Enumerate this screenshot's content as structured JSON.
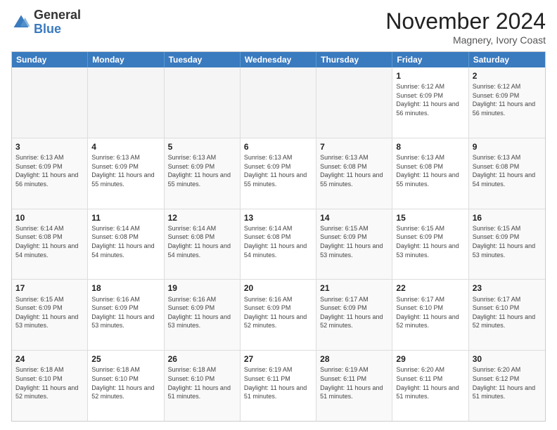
{
  "header": {
    "logo_general": "General",
    "logo_blue": "Blue",
    "month": "November 2024",
    "location": "Magnery, Ivory Coast"
  },
  "days_of_week": [
    "Sunday",
    "Monday",
    "Tuesday",
    "Wednesday",
    "Thursday",
    "Friday",
    "Saturday"
  ],
  "weeks": [
    [
      {
        "day": "",
        "text": ""
      },
      {
        "day": "",
        "text": ""
      },
      {
        "day": "",
        "text": ""
      },
      {
        "day": "",
        "text": ""
      },
      {
        "day": "",
        "text": ""
      },
      {
        "day": "1",
        "text": "Sunrise: 6:12 AM\nSunset: 6:09 PM\nDaylight: 11 hours and 56 minutes."
      },
      {
        "day": "2",
        "text": "Sunrise: 6:12 AM\nSunset: 6:09 PM\nDaylight: 11 hours and 56 minutes."
      }
    ],
    [
      {
        "day": "3",
        "text": "Sunrise: 6:13 AM\nSunset: 6:09 PM\nDaylight: 11 hours and 56 minutes."
      },
      {
        "day": "4",
        "text": "Sunrise: 6:13 AM\nSunset: 6:09 PM\nDaylight: 11 hours and 55 minutes."
      },
      {
        "day": "5",
        "text": "Sunrise: 6:13 AM\nSunset: 6:09 PM\nDaylight: 11 hours and 55 minutes."
      },
      {
        "day": "6",
        "text": "Sunrise: 6:13 AM\nSunset: 6:09 PM\nDaylight: 11 hours and 55 minutes."
      },
      {
        "day": "7",
        "text": "Sunrise: 6:13 AM\nSunset: 6:08 PM\nDaylight: 11 hours and 55 minutes."
      },
      {
        "day": "8",
        "text": "Sunrise: 6:13 AM\nSunset: 6:08 PM\nDaylight: 11 hours and 55 minutes."
      },
      {
        "day": "9",
        "text": "Sunrise: 6:13 AM\nSunset: 6:08 PM\nDaylight: 11 hours and 54 minutes."
      }
    ],
    [
      {
        "day": "10",
        "text": "Sunrise: 6:14 AM\nSunset: 6:08 PM\nDaylight: 11 hours and 54 minutes."
      },
      {
        "day": "11",
        "text": "Sunrise: 6:14 AM\nSunset: 6:08 PM\nDaylight: 11 hours and 54 minutes."
      },
      {
        "day": "12",
        "text": "Sunrise: 6:14 AM\nSunset: 6:08 PM\nDaylight: 11 hours and 54 minutes."
      },
      {
        "day": "13",
        "text": "Sunrise: 6:14 AM\nSunset: 6:08 PM\nDaylight: 11 hours and 54 minutes."
      },
      {
        "day": "14",
        "text": "Sunrise: 6:15 AM\nSunset: 6:09 PM\nDaylight: 11 hours and 53 minutes."
      },
      {
        "day": "15",
        "text": "Sunrise: 6:15 AM\nSunset: 6:09 PM\nDaylight: 11 hours and 53 minutes."
      },
      {
        "day": "16",
        "text": "Sunrise: 6:15 AM\nSunset: 6:09 PM\nDaylight: 11 hours and 53 minutes."
      }
    ],
    [
      {
        "day": "17",
        "text": "Sunrise: 6:15 AM\nSunset: 6:09 PM\nDaylight: 11 hours and 53 minutes."
      },
      {
        "day": "18",
        "text": "Sunrise: 6:16 AM\nSunset: 6:09 PM\nDaylight: 11 hours and 53 minutes."
      },
      {
        "day": "19",
        "text": "Sunrise: 6:16 AM\nSunset: 6:09 PM\nDaylight: 11 hours and 53 minutes."
      },
      {
        "day": "20",
        "text": "Sunrise: 6:16 AM\nSunset: 6:09 PM\nDaylight: 11 hours and 52 minutes."
      },
      {
        "day": "21",
        "text": "Sunrise: 6:17 AM\nSunset: 6:09 PM\nDaylight: 11 hours and 52 minutes."
      },
      {
        "day": "22",
        "text": "Sunrise: 6:17 AM\nSunset: 6:10 PM\nDaylight: 11 hours and 52 minutes."
      },
      {
        "day": "23",
        "text": "Sunrise: 6:17 AM\nSunset: 6:10 PM\nDaylight: 11 hours and 52 minutes."
      }
    ],
    [
      {
        "day": "24",
        "text": "Sunrise: 6:18 AM\nSunset: 6:10 PM\nDaylight: 11 hours and 52 minutes."
      },
      {
        "day": "25",
        "text": "Sunrise: 6:18 AM\nSunset: 6:10 PM\nDaylight: 11 hours and 52 minutes."
      },
      {
        "day": "26",
        "text": "Sunrise: 6:18 AM\nSunset: 6:10 PM\nDaylight: 11 hours and 51 minutes."
      },
      {
        "day": "27",
        "text": "Sunrise: 6:19 AM\nSunset: 6:11 PM\nDaylight: 11 hours and 51 minutes."
      },
      {
        "day": "28",
        "text": "Sunrise: 6:19 AM\nSunset: 6:11 PM\nDaylight: 11 hours and 51 minutes."
      },
      {
        "day": "29",
        "text": "Sunrise: 6:20 AM\nSunset: 6:11 PM\nDaylight: 11 hours and 51 minutes."
      },
      {
        "day": "30",
        "text": "Sunrise: 6:20 AM\nSunset: 6:12 PM\nDaylight: 11 hours and 51 minutes."
      }
    ]
  ]
}
